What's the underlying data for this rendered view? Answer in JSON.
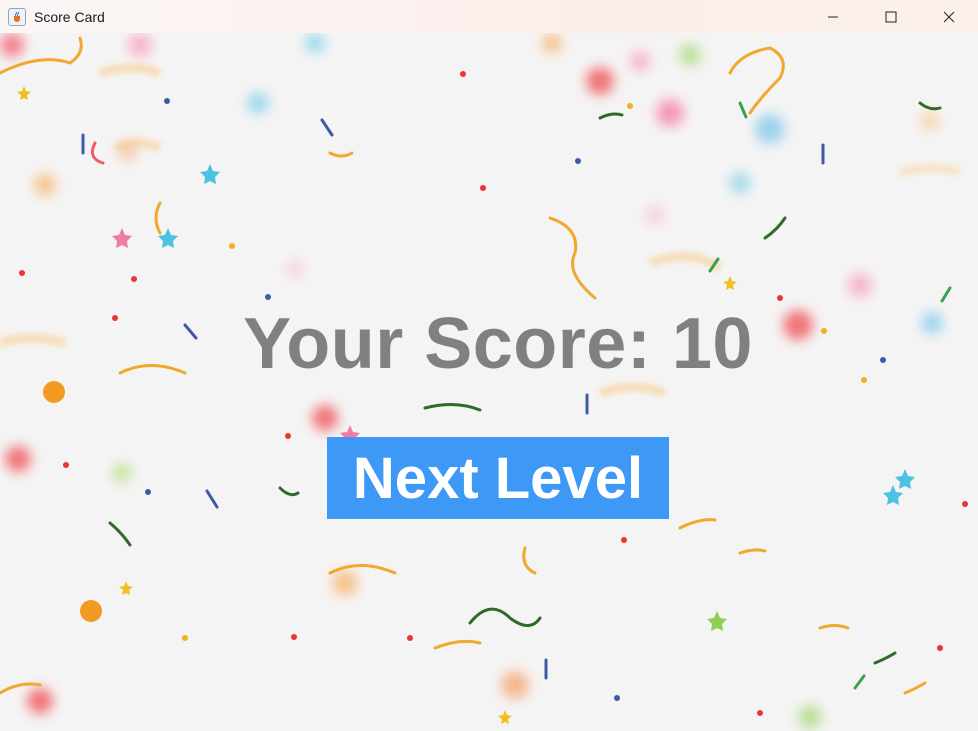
{
  "window": {
    "title": "Score Card",
    "icon": "java-cup-icon",
    "controls": [
      "minimize-icon",
      "maximize-icon",
      "close-icon"
    ]
  },
  "score": {
    "text": "Your Score: 10",
    "value": 10
  },
  "buttons": {
    "next_label": "Next Level"
  },
  "colors": {
    "score_text": "#808080",
    "button_bg": "#3d99f5",
    "button_text": "#ffffff"
  },
  "background": {
    "description_icon": "confetti-background"
  }
}
